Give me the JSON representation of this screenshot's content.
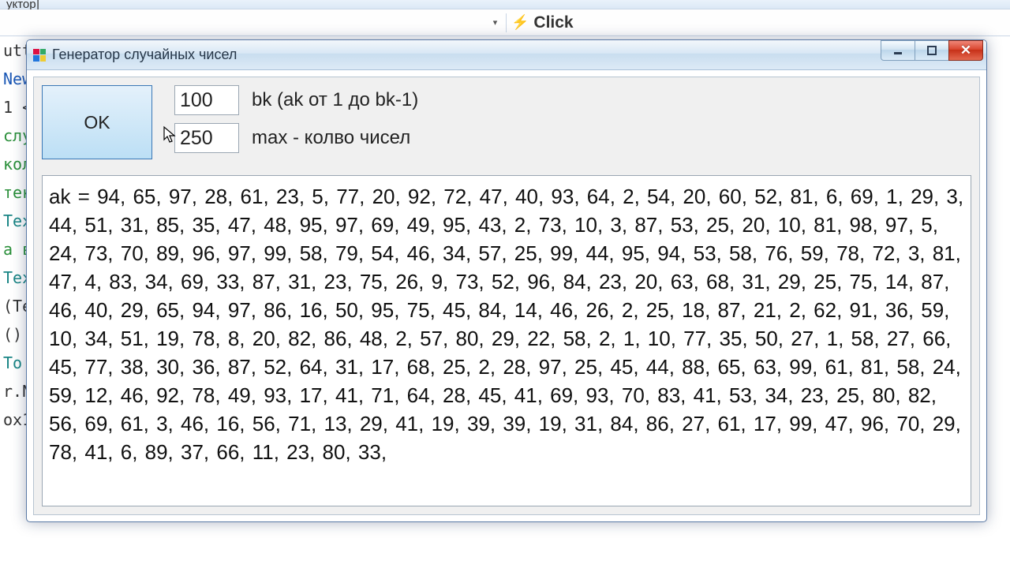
{
  "bg": {
    "tab_fragment": "уктор]",
    "toolbar_event": "Click",
    "code_lines": [
      {
        "t": "",
        "c": ""
      },
      {
        "t": "utt",
        "c": ""
      },
      {
        "t": "New",
        "c": "kw-blue"
      },
      {
        "t": "1 <",
        "c": ""
      },
      {
        "t": "слу",
        "c": "kw-green"
      },
      {
        "t": "кол",
        "c": "kw-green"
      },
      {
        "t": "",
        "c": ""
      },
      {
        "t": "тек",
        "c": "kw-green"
      },
      {
        "t": "Tex",
        "c": "kw-teal"
      },
      {
        "t": "а в",
        "c": "kw-green"
      },
      {
        "t": "Tex",
        "c": "kw-teal"
      },
      {
        "t": "(Te",
        "c": ""
      },
      {
        "t": "",
        "c": ""
      },
      {
        "t": "()",
        "c": ""
      },
      {
        "t": "To",
        "c": "kw-teal"
      },
      {
        "t": "",
        "c": ""
      },
      {
        "t": "r.N",
        "c": ""
      },
      {
        "t": "",
        "c": ""
      },
      {
        "t": "ox1",
        "c": ""
      }
    ]
  },
  "window": {
    "title": "Генератор случайных чисел"
  },
  "controls": {
    "ok_label": "OK",
    "bk_value": "100",
    "bk_label": "bk  (ak от 1 до bk-1)",
    "max_value": "250",
    "max_label": "max - колво чисел"
  },
  "output": {
    "prefix": "ak = ",
    "values": [
      94,
      65,
      97,
      28,
      61,
      23,
      5,
      77,
      20,
      92,
      72,
      47,
      40,
      93,
      64,
      2,
      54,
      20,
      60,
      52,
      81,
      6,
      69,
      1,
      29,
      3,
      44,
      51,
      31,
      85,
      35,
      47,
      48,
      95,
      97,
      69,
      49,
      95,
      43,
      2,
      73,
      10,
      3,
      87,
      53,
      25,
      20,
      10,
      81,
      98,
      97,
      5,
      24,
      73,
      70,
      89,
      96,
      97,
      99,
      58,
      79,
      54,
      46,
      34,
      57,
      25,
      99,
      44,
      95,
      94,
      53,
      58,
      76,
      59,
      78,
      72,
      3,
      81,
      47,
      4,
      83,
      34,
      69,
      33,
      87,
      31,
      23,
      75,
      26,
      9,
      73,
      52,
      96,
      84,
      23,
      20,
      63,
      68,
      31,
      29,
      25,
      75,
      14,
      87,
      46,
      40,
      29,
      65,
      94,
      97,
      86,
      16,
      50,
      95,
      75,
      45,
      84,
      14,
      46,
      26,
      2,
      25,
      18,
      87,
      21,
      2,
      62,
      91,
      36,
      59,
      10,
      34,
      51,
      19,
      78,
      8,
      20,
      82,
      86,
      48,
      2,
      57,
      80,
      29,
      22,
      58,
      2,
      1,
      10,
      77,
      35,
      50,
      27,
      1,
      58,
      27,
      66,
      45,
      77,
      38,
      30,
      36,
      87,
      52,
      64,
      31,
      17,
      68,
      25,
      2,
      28,
      97,
      25,
      45,
      44,
      88,
      65,
      63,
      99,
      61,
      81,
      58,
      24,
      59,
      12,
      46,
      92,
      78,
      49,
      93,
      17,
      41,
      71,
      64,
      28,
      45,
      41,
      69,
      93,
      70,
      83,
      41,
      53,
      34,
      23,
      25,
      80,
      82,
      56,
      69,
      61,
      3,
      46,
      16,
      56,
      71,
      13,
      29,
      41,
      19,
      39,
      39,
      19,
      31,
      84,
      86,
      27,
      61,
      17,
      99,
      47,
      96,
      70,
      29,
      78,
      41,
      6,
      89,
      37,
      66,
      11,
      23,
      80,
      33
    ]
  }
}
